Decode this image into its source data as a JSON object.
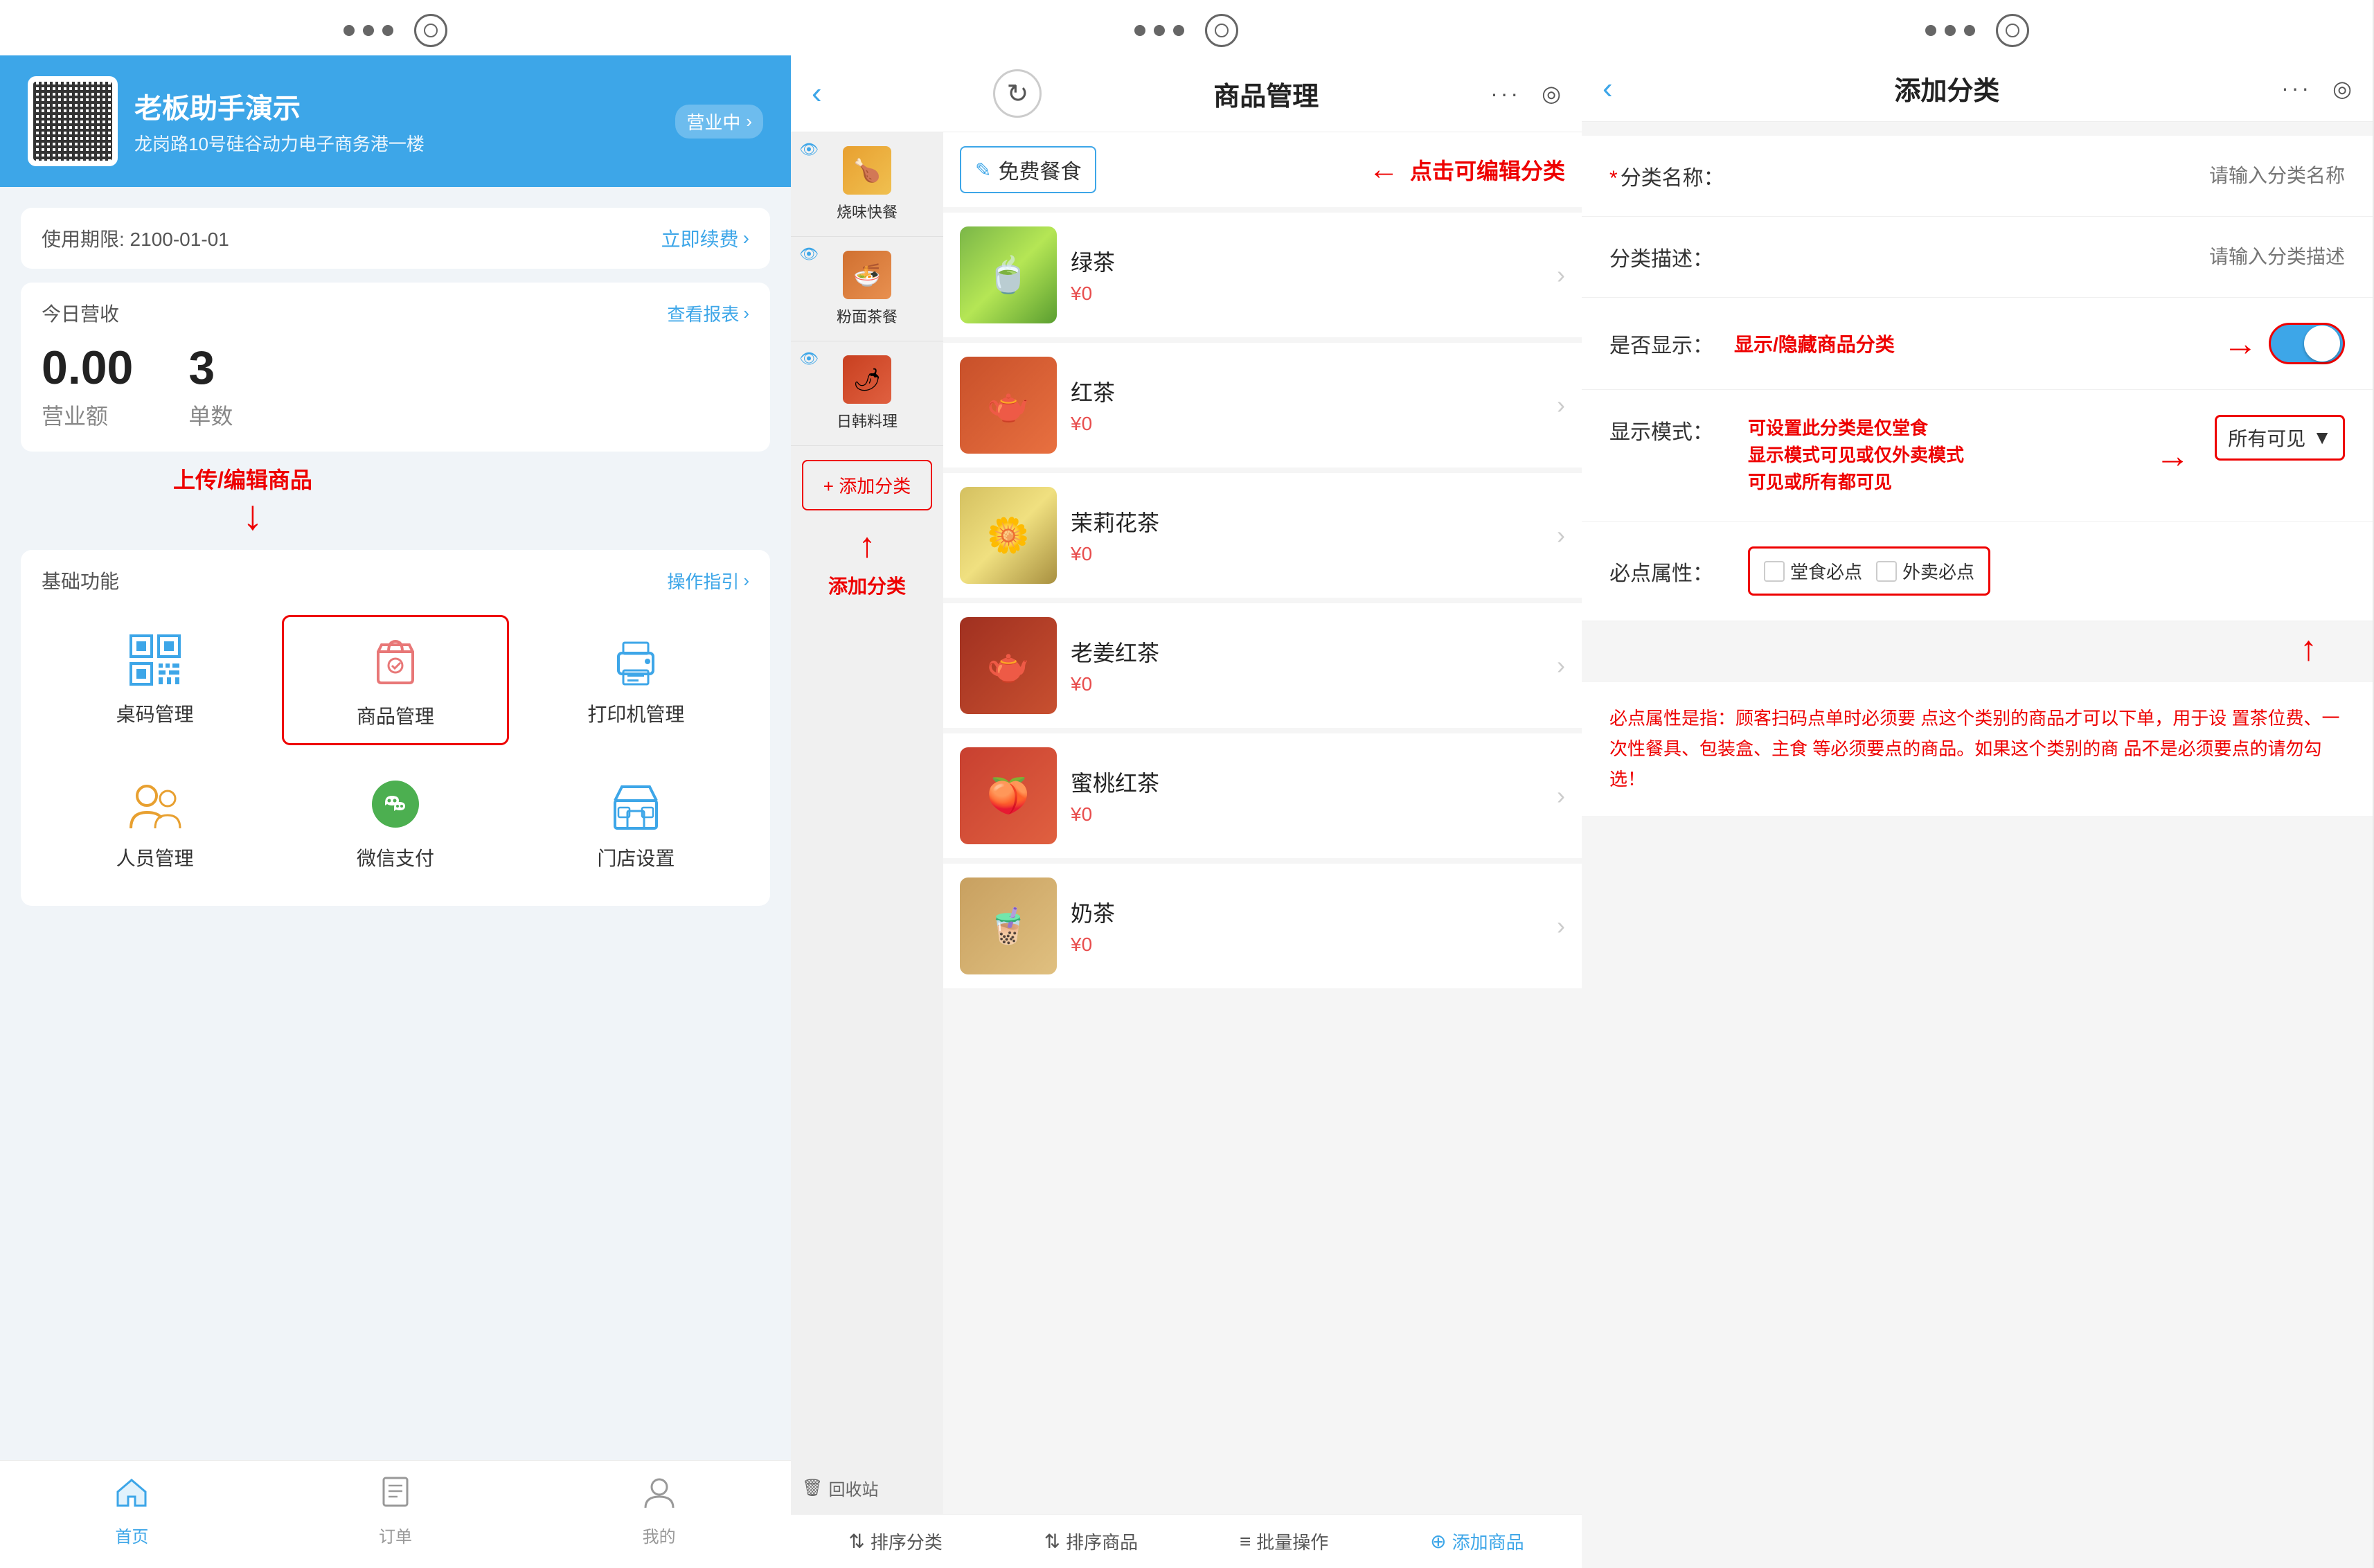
{
  "phone1": {
    "store": {
      "name": "老板助手演示",
      "address": "龙岗路10号硅谷动力电子商务港一楼",
      "status": "营业中"
    },
    "expiry": {
      "label": "使用期限: 2100-01-01",
      "link": "立即续费"
    },
    "revenue": {
      "title": "今日营收",
      "report_link": "查看报表",
      "amount": "0.00",
      "amount_unit": "营业额",
      "order_count": "3",
      "order_unit": "单数"
    },
    "functions": {
      "title": "基础功能",
      "guide": "操作指引",
      "items": [
        {
          "id": "qrcode",
          "label": "桌码管理",
          "icon": "qr"
        },
        {
          "id": "product",
          "label": "商品管理",
          "icon": "bag",
          "highlighted": true
        },
        {
          "id": "printer",
          "label": "打印机管理",
          "icon": "printer"
        },
        {
          "id": "staff",
          "label": "人员管理",
          "icon": "people"
        },
        {
          "id": "wechat",
          "label": "微信支付",
          "icon": "wechat"
        },
        {
          "id": "store",
          "label": "门店设置",
          "icon": "store"
        }
      ]
    },
    "annotation_upload": "上传/编辑商品",
    "nav": {
      "items": [
        {
          "id": "home",
          "label": "首页",
          "active": true
        },
        {
          "id": "order",
          "label": "订单",
          "active": false
        },
        {
          "id": "profile",
          "label": "我的",
          "active": false
        }
      ]
    }
  },
  "phone2": {
    "title": "商品管理",
    "categories": [
      {
        "id": "fast-food",
        "label": "烧味快餐",
        "has_eye": true
      },
      {
        "id": "noodle",
        "label": "粉面茶餐",
        "has_eye": true
      },
      {
        "id": "korean",
        "label": "日韩料理",
        "has_eye": true
      }
    ],
    "add_category_label": "+ 添加分类",
    "add_annotation": "添加分类",
    "active_category": "免费餐食",
    "click_annotation": "点击可编辑分类",
    "products": [
      {
        "id": "green-tea",
        "name": "绿茶",
        "price": "¥0",
        "img_class": "img-green-tea"
      },
      {
        "id": "red-tea",
        "name": "红茶",
        "price": "¥0",
        "img_class": "img-red-tea"
      },
      {
        "id": "jasmine-tea",
        "name": "茉莉花茶",
        "price": "¥0",
        "img_class": "img-jasmine-tea"
      },
      {
        "id": "ginger-red-tea",
        "name": "老姜红茶",
        "price": "¥0",
        "img_class": "img-ginger-red-tea"
      },
      {
        "id": "peach-tea",
        "name": "蜜桃红茶",
        "price": "¥0",
        "img_class": "img-peach-tea"
      },
      {
        "id": "milk-tea",
        "name": "奶茶",
        "price": "¥0",
        "img_class": "img-milk-tea"
      }
    ],
    "recycle_label": "回收站",
    "bottom_bar": {
      "sort_category": "排序分类",
      "sort_product": "排序商品",
      "batch_op": "批量操作",
      "add_product": "添加商品"
    }
  },
  "phone3": {
    "title": "添加分类",
    "form": {
      "name_label": "*分类名称：",
      "name_placeholder": "请输入分类名称",
      "desc_label": "分类描述：",
      "desc_placeholder": "请输入分类描述",
      "show_label": "是否显示：",
      "show_annotation": "显示/隐藏商品分类",
      "toggle_on": true,
      "display_mode_label": "显示模式：",
      "display_mode_annotation": "可设置此分类是仅堂食\n显示模式可见或仅外卖模式\n可见或所有都可见",
      "display_mode_value": "所有可见",
      "must_label": "必点属性：",
      "must_annotation": "→",
      "must_options": [
        "堂食必点",
        "外卖必点"
      ]
    },
    "description": "必点属性是指：顾客扫码点单时必须要\n点这个类别的商品才可以下单，用于设\n置茶位费、一次性餐具、包装盒、主食\n等必须要点的商品。如果这个类别的商\n品不是必须要点的请勿勾选！"
  },
  "icons": {
    "back": "‹",
    "chevron_right": "›",
    "refresh": "↻",
    "eye": "●",
    "recycle": "🗑",
    "sort_icon": "⇅",
    "batch_icon": "≡",
    "add_circle": "⊕",
    "edit_icon": "✎",
    "chevron_down": "▼"
  },
  "colors": {
    "primary": "#3da6e8",
    "red": "#e00000",
    "text_dark": "#222",
    "text_mid": "#555",
    "text_light": "#999",
    "border": "#eee"
  }
}
